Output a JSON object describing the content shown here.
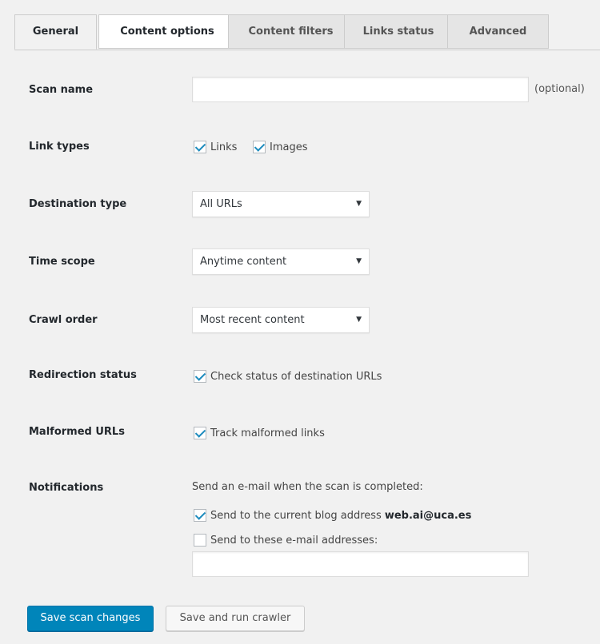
{
  "tabs": [
    {
      "label": "General",
      "active": true
    },
    {
      "label": "Content options",
      "active": false
    },
    {
      "label": "Content filters",
      "active": false
    },
    {
      "label": "Links status",
      "active": false
    },
    {
      "label": "Advanced",
      "active": false
    }
  ],
  "form": {
    "scan_name": {
      "label": "Scan name",
      "value": "",
      "hint": "(optional)"
    },
    "link_types": {
      "label": "Link types",
      "options": [
        {
          "label": "Links",
          "checked": true
        },
        {
          "label": "Images",
          "checked": true
        }
      ]
    },
    "destination_type": {
      "label": "Destination type",
      "selected": "All URLs"
    },
    "time_scope": {
      "label": "Time scope",
      "selected": "Anytime content"
    },
    "crawl_order": {
      "label": "Crawl order",
      "selected": "Most recent content"
    },
    "redirection_status": {
      "label": "Redirection status",
      "option": "Check status of destination URLs",
      "checked": true
    },
    "malformed_urls": {
      "label": "Malformed URLs",
      "option": "Track malformed links",
      "checked": true
    },
    "notifications": {
      "label": "Notifications",
      "description": "Send an e-mail when the scan is completed:",
      "blog_option": "Send to the current blog address",
      "blog_email": "web.ai@uca.es",
      "blog_checked": true,
      "custom_option": "Send to these e-mail addresses:",
      "custom_checked": false,
      "custom_value": ""
    }
  },
  "buttons": {
    "save": "Save scan changes",
    "save_run": "Save and run crawler"
  },
  "colors": {
    "primary": "#0085ba",
    "checkmark": "#1e8cbe",
    "background": "#f1f1f1"
  }
}
